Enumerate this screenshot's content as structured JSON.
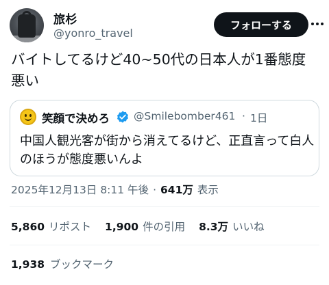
{
  "author": {
    "name": "旅杉",
    "handle": "@yonro_travel",
    "follow_label": "フォローする"
  },
  "tweet": {
    "text": "バイトしてるけど40~50代の日本人が1番態度悪い"
  },
  "quote": {
    "name": "笑顔で決めろ",
    "handle": "@Smilebomber461",
    "dot": "·",
    "time": "1日",
    "text": "中国人観光客が街から消えてるけど、正直言って白人のほうが態度悪いんよ"
  },
  "meta": {
    "date": "2025年12月13日 8:11 午後",
    "separator": "·",
    "views": "641万",
    "views_label": "表示"
  },
  "stats": {
    "reposts": "5,860",
    "reposts_label": "リポスト",
    "quotes": "1,900",
    "quotes_label": "件の引用",
    "likes": "8.3万",
    "likes_label": "いいね",
    "bookmarks": "1,938",
    "bookmarks_label": "ブックマーク"
  },
  "colors": {
    "text": "#0f1419",
    "secondary": "#536471",
    "verified": "#1d9bf0",
    "border": "#cfd9de"
  },
  "icons": {
    "more": "more-icon",
    "verified": "verified-badge-icon"
  }
}
